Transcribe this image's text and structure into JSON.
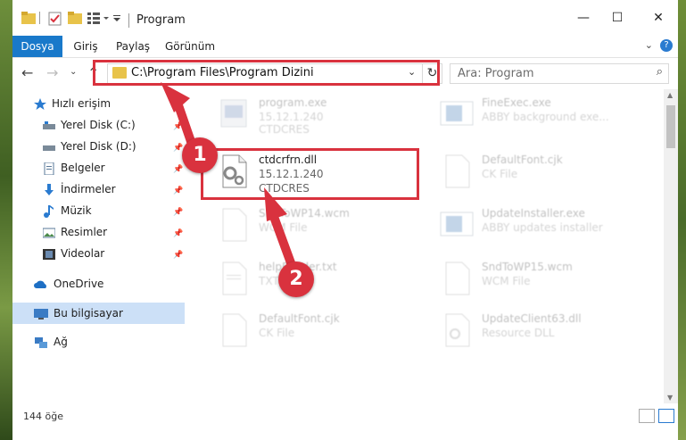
{
  "window": {
    "title": "Program",
    "buttons": {
      "minimize": "—",
      "maximize": "☐",
      "close": "✕"
    }
  },
  "ribbon": {
    "tabs": [
      {
        "label": "Dosya",
        "active": true
      },
      {
        "label": "Giriş",
        "active": false
      },
      {
        "label": "Paylaş",
        "active": false
      },
      {
        "label": "Görünüm",
        "active": false
      }
    ],
    "help": "?"
  },
  "navigation": {
    "address": "C:\\Program Files\\Program Dizini",
    "search_placeholder": "Ara: Program"
  },
  "sidebar": {
    "quick_access": "Hızlı erişim",
    "items": [
      {
        "label": "Yerel Disk (C:)",
        "icon": "drive-icon",
        "pinned": true
      },
      {
        "label": "Yerel Disk (D:)",
        "icon": "drive-icon",
        "pinned": true
      },
      {
        "label": "Belgeler",
        "icon": "documents-icon",
        "pinned": true
      },
      {
        "label": "İndirmeler",
        "icon": "downloads-icon",
        "pinned": true
      },
      {
        "label": "Müzik",
        "icon": "music-icon",
        "pinned": true
      },
      {
        "label": "Resimler",
        "icon": "pictures-icon",
        "pinned": true
      },
      {
        "label": "Videolar",
        "icon": "videos-icon",
        "pinned": true
      }
    ],
    "onedrive": "OneDrive",
    "this_pc": "Bu bilgisayar",
    "network": "Ağ"
  },
  "files": [
    {
      "name": "program.exe",
      "line2": "15.12.1.240",
      "line3": "CTDCRES",
      "faded": true
    },
    {
      "name": "FineExec.exe",
      "line2": "ABBY background exe...",
      "line3": "",
      "faded": true
    },
    {
      "name": "ctdcrfrn.dll",
      "line2": "15.12.1.240",
      "line3": "CTDCRES",
      "faded": false
    },
    {
      "name": "DefaultFont.cjk",
      "line2": "CK File",
      "line3": "",
      "faded": true
    },
    {
      "name": "SndToWP14.wcm",
      "line2": "WCM File",
      "line3": "",
      "faded": true
    },
    {
      "name": "UpdateInstaller.exe",
      "line2": "ABBY updates installer",
      "line3": "",
      "faded": true
    },
    {
      "name": "helpReader.txt",
      "line2": "TXT File",
      "line3": "",
      "faded": true
    },
    {
      "name": "SndToWP15.wcm",
      "line2": "WCM File",
      "line3": "",
      "faded": true
    },
    {
      "name": "DefaultFont.cjk",
      "line2": "CK File",
      "line3": "",
      "faded": true
    },
    {
      "name": "UpdateClient63.dll",
      "line2": "Resource DLL",
      "line3": "",
      "faded": true
    }
  ],
  "status": {
    "item_count": "144 öğe"
  },
  "callouts": [
    "1",
    "2"
  ],
  "colors": {
    "accent": "#1979ca",
    "highlight": "#d9323e",
    "selection": "#cce0f7"
  }
}
